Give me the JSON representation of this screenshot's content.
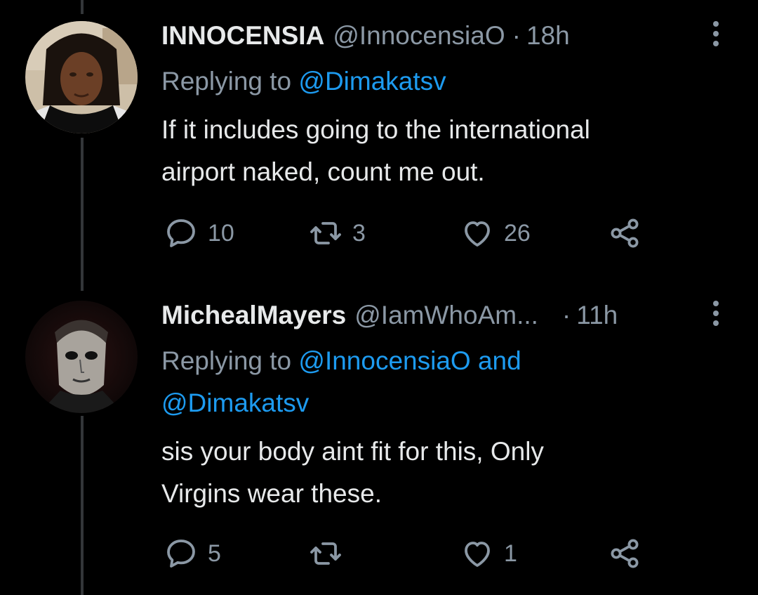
{
  "tweets": [
    {
      "display_name": "INNOCENSIA",
      "handle": "@InnocensiaO",
      "separator": "·",
      "time": "18h",
      "replying_prefix": "Replying to",
      "replying_mentions": "@Dimakatsv",
      "body_line1": "If it includes going to the international",
      "body_line2": "airport naked, count me out.",
      "reply_count": "10",
      "retweet_count": "3",
      "like_count": "26"
    },
    {
      "display_name": "MichealMayers",
      "handle": "@IamWhoAm...",
      "separator": "·",
      "time": "11h",
      "replying_prefix": "Replying to",
      "replying_mentions": "@InnocensiaO and",
      "replying_mentions_2": "@Dimakatsv",
      "body_line1": "sis your body aint fit for this, Only",
      "body_line2": "Virgins wear these.",
      "reply_count": "5",
      "retweet_count": "",
      "like_count": "1"
    }
  ],
  "icons": {
    "reply": "reply-icon",
    "retweet": "retweet-icon",
    "like": "heart-icon",
    "share": "share-icon",
    "more": "more-vertical-icon"
  },
  "colors": {
    "background": "#000000",
    "text": "#e7e9ea",
    "secondary": "#8b98a5",
    "link": "#1d9bf0",
    "thread_line": "#333639"
  }
}
